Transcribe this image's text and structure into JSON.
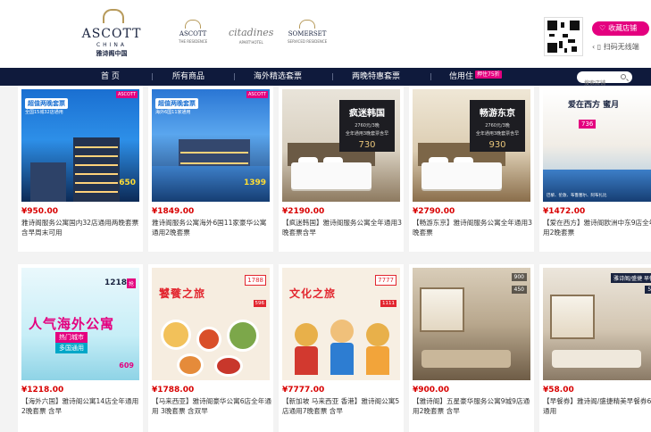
{
  "header": {
    "brand": {
      "name": "ASCOTT",
      "sub_en": "CHINA",
      "sub_cn": "雅诗阁中国"
    },
    "sub_brands": [
      {
        "name": "ASCOTT",
        "sub": "THE RESIDENCE"
      },
      {
        "name": "citadines",
        "sub": "APART'HOTEL"
      },
      {
        "name": "SOMERSET",
        "sub": "SERVICED RESIDENCE"
      }
    ],
    "fav_button": "收藏店铺",
    "scan_text": "扫码无线端"
  },
  "nav": {
    "items": [
      "首 页",
      "所有商品",
      "海外精选套票",
      "两晚特惠套票",
      "信用住"
    ],
    "hot_badge": "押住75折",
    "search_placeholder": "搜索店铺"
  },
  "products": [
    {
      "price": "¥950.00",
      "title": "雅诗阁服务公寓国内32店通用两晚套票 含早周末可用",
      "poster": {
        "tag": "超值两晚套票",
        "sub": "全国15城32店通用",
        "price": "650"
      }
    },
    {
      "price": "¥1849.00",
      "title": "雅诗阁服务公寓海外6国11家豪华公寓通用2晚套票",
      "poster": {
        "tag": "超值两晚套票",
        "sub": "海外6国11家通用",
        "price": "1399"
      }
    },
    {
      "price": "¥2190.00",
      "title": "【疯迷韩国】雅诗阁服务公寓全年通用3晚套票含早",
      "poster": {
        "t1": "疯迷韩国",
        "t2": "2760元/3晚",
        "t3": "全年通用3晚套票含早",
        "t4": "730"
      }
    },
    {
      "price": "¥2790.00",
      "title": "【畅游东京】雅诗阁服务公寓全年通用3晚套票",
      "poster": {
        "t1": "畅游东京",
        "t2": "2760元/3晚",
        "t3": "全年通用3晚套票含早",
        "t4": "930"
      }
    },
    {
      "price": "¥1472.00",
      "title": "【爱在西方】雅诗阁欧洲中东9店全年通用2晚套票",
      "poster": {
        "t1": "爱在西方 蜜月",
        "t2": "736",
        "t3": "巴黎、伦敦、布鲁塞尔、阿布扎比"
      }
    },
    {
      "price": "¥1218.00",
      "title": "【海外六国】雅诗阁公寓14店全年通用 2晚套票 含早",
      "poster": {
        "badge": "1218",
        "title": "人气海外公寓",
        "bar1": "热门城市",
        "bar2": "多国通用",
        "price": "609"
      }
    },
    {
      "price": "¥1788.00",
      "title": "【马来西亚】雅诗阁豪华公寓6店全年通用 3晚套票 含双早",
      "poster": {
        "title": "饕餮之旅",
        "badge": "1788",
        "bar": "596"
      }
    },
    {
      "price": "¥7777.00",
      "title": "【新加坡 马来西亚 香港】雅诗阁公寓5店通用7晚套票 含早",
      "poster": {
        "title": "文化之旅",
        "badge": "7777",
        "bar": "1111"
      }
    },
    {
      "price": "¥900.00",
      "title": "【雅诗阁】五星豪华服务公寓9城9店通用2晚套票 含早",
      "poster": {
        "tag": "900",
        "tag2": "450"
      }
    },
    {
      "price": "¥58.00",
      "title": "【早餐券】雅诗阁/盛捷精美早餐券6店通用",
      "poster": {
        "tag": "雅诗阁/盛捷 早餐",
        "tag2": "58"
      }
    }
  ],
  "colors": {
    "nav_bg": "#0f1a3c",
    "accent": "#e4007f",
    "price": "#d80000",
    "brand": "#1a2440"
  }
}
